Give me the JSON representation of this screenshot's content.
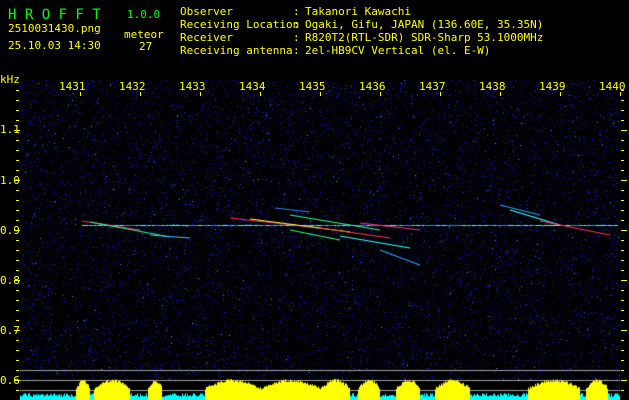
{
  "app": {
    "name": "H R O F F T",
    "version": "1.0.0"
  },
  "file": {
    "name": "2510031430.png",
    "datetime": "25.10.03 14:30"
  },
  "meteor": {
    "label": "meteor",
    "count": "27"
  },
  "info": [
    {
      "key": "Observer",
      "value": "Takanori Kawachi"
    },
    {
      "key": "Receiving Location",
      "value": "Ogaki, Gifu, JAPAN (136.60E, 35.35N)"
    },
    {
      "key": "Receiver",
      "value": "R820T2(RTL-SDR) SDR-Sharp 53.1000MHz"
    },
    {
      "key": "Receiving antenna",
      "value": "2el-HB9CV Vertical (el. E-W)"
    }
  ],
  "axes": {
    "y_unit": "kHz",
    "x_ticks": [
      "1431",
      "1432",
      "1433",
      "1434",
      "1435",
      "1436",
      "1437",
      "1438",
      "1439",
      "1440"
    ],
    "y_ticks": [
      "1.1",
      "1.0",
      "0.9",
      "0.8",
      "0.7",
      "0.6"
    ]
  },
  "colors": {
    "text": "#ffff00",
    "title": "#00ff00",
    "histogram": "#ffff00",
    "histogram_base": "#00ffff",
    "noise": "#1010c0"
  }
}
